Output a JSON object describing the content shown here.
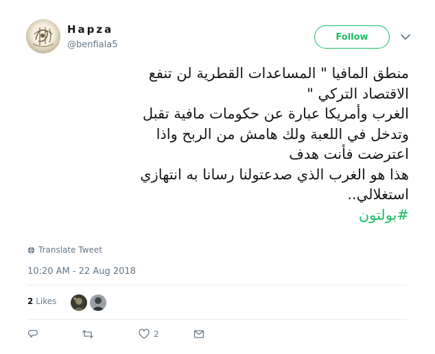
{
  "user": {
    "name": "Hapza",
    "handle": "@benfiala5"
  },
  "follow_label": "Follow",
  "tweet": {
    "lines": [
      "منطق المافيا \" المساعدات القطرية لن تنفع",
      "الاقتصاد التركي \"",
      "الغرب وأمريكا عبارة عن حكومات مافية تقبل",
      "وتدخل في اللعبة ولك هامش من الربح واذا",
      "اعترضت فأنت هدف",
      "هذا هو الغرب الذي صدعتولنا رسانا به انتهازي",
      "استغلالي.."
    ],
    "hashtag": "#بولتون"
  },
  "translate_label": "Translate Tweet",
  "timestamp": "10:20 AM - 22 Aug 2018",
  "likes": {
    "count": "2",
    "label": "Likes"
  },
  "actions": {
    "like_count": "2"
  },
  "colors": {
    "accent": "#17bf63",
    "secondary_text": "#657786",
    "primary_text": "#14171a",
    "divider": "#e6ecf0"
  },
  "icons": [
    "globe-icon",
    "chevron-down-icon",
    "reply-icon",
    "retweet-icon",
    "heart-icon",
    "envelope-icon"
  ]
}
